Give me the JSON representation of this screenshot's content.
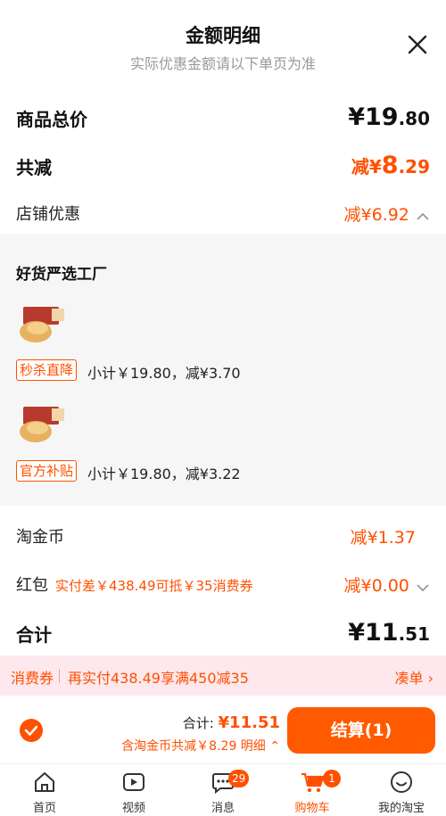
{
  "header": {
    "title": "金额明细",
    "subtitle": "实际优惠金额请以下单页为准"
  },
  "summary": {
    "total_label": "商品总价",
    "total_int": "¥19",
    "total_dec": ".80",
    "reduce_label": "共减",
    "reduce_prefix": "减¥",
    "reduce_int": "8",
    "reduce_dec": ".29",
    "shop_discount_label": "店铺优惠",
    "shop_discount_value": "减¥6.92"
  },
  "shop": {
    "name": "好货严选工厂",
    "items": [
      {
        "tag": "秒杀直降",
        "subtotal": "小计￥19.80，减¥3.70"
      },
      {
        "tag": "官方补贴",
        "subtotal": "小计￥19.80，减¥3.22"
      }
    ]
  },
  "extras": {
    "coin_label": "淘金币",
    "coin_value": "减¥1.37",
    "hongbao_label": "红包",
    "hongbao_hint": "实付差￥438.49可抵￥35消费券",
    "hongbao_value": "减¥0.00",
    "heji_label": "合计",
    "heji_int": "¥11",
    "heji_dec": ".51"
  },
  "coupon": {
    "label": "消费券",
    "text": "再实付438.49享满450减35",
    "action": "凑单 ›"
  },
  "checkout": {
    "sum_label": "合计: ",
    "sum_value": "¥11.51",
    "note": "含淘金币共减￥8.29  明细 ⌃",
    "pay_button": "结算(1)"
  },
  "tabs": [
    {
      "label": "首页"
    },
    {
      "label": "视频"
    },
    {
      "label": "消息",
      "badge": "29"
    },
    {
      "label": "购物车",
      "badge": "1"
    },
    {
      "label": "我的淘宝"
    }
  ],
  "colors": {
    "accent": "#ff5000",
    "coupon_bg": "#fde8ee",
    "panel_bg": "#f6f6f6"
  }
}
